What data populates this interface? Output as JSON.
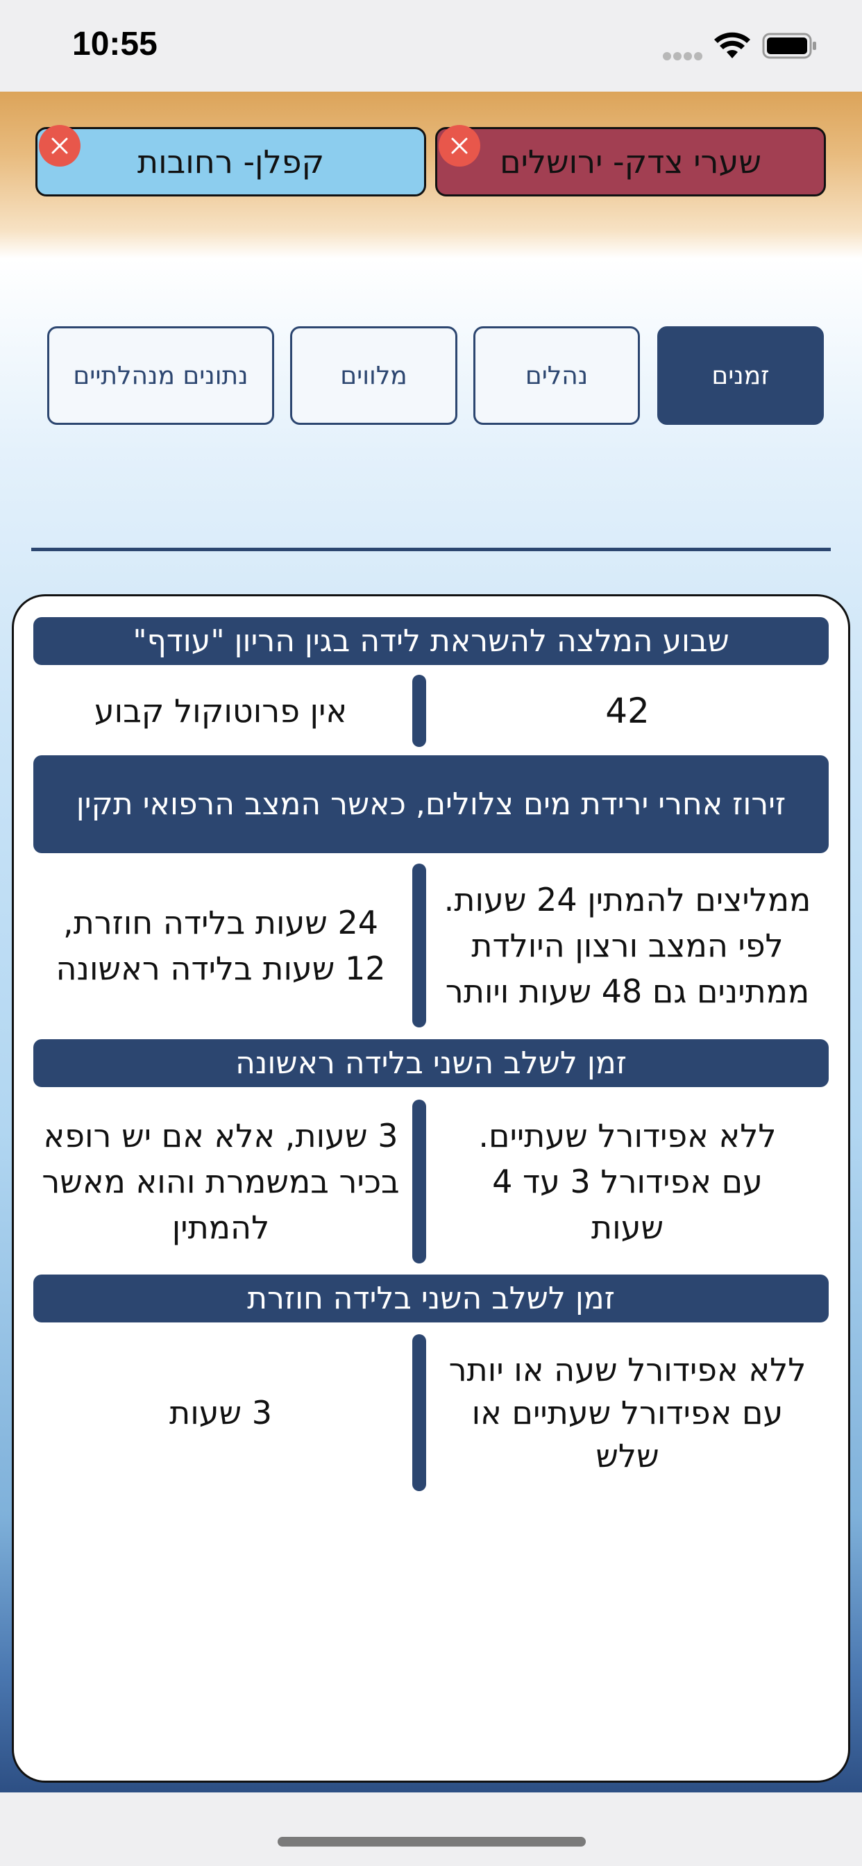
{
  "status_bar": {
    "time": "10:55"
  },
  "hospital_tabs": [
    {
      "label": "קפלן- רחובות",
      "color": "#8ccdee"
    },
    {
      "label": "שערי צדק- ירושלים",
      "color": "#a23f52"
    }
  ],
  "segments": [
    {
      "label": "זמנים",
      "active": true
    },
    {
      "label": "נהלים",
      "active": false
    },
    {
      "label": "מלווים",
      "active": false
    },
    {
      "label": "נתונים מנהלתיים",
      "active": false
    }
  ],
  "sections": [
    {
      "header": "שבוע המלצה להשראת לידה בגין הריון \"עודף\"",
      "right": "42",
      "left": "אין פרוטוקול קבוע"
    },
    {
      "header": "זירוז אחרי ירידת מים צלולים, כאשר המצב הרפואי תקין",
      "right": "ממליצים להמתין 24 שעות. לפי המצב ורצון היולדת ממתינים גם 48 שעות ויותר",
      "left": "24 שעות בלידה חוזרת, 12 שעות בלידה ראשונה"
    },
    {
      "header": "זמן לשלב השני בלידה ראשונה",
      "right": "ללא אפידורל שעתיים. עם אפידורל 3 עד 4 שעות",
      "left": "3 שעות, אלא אם יש רופא בכיר במשמרת והוא מאשר להמתין"
    },
    {
      "header": "זמן לשלב השני בלידה חוזרת",
      "right": "ללא אפידורל שעה או יותר עם אפידורל  שעתיים או שלש",
      "left": "3 שעות"
    }
  ],
  "colors": {
    "accent": "#2c4670",
    "close_badge": "#e8574b"
  }
}
